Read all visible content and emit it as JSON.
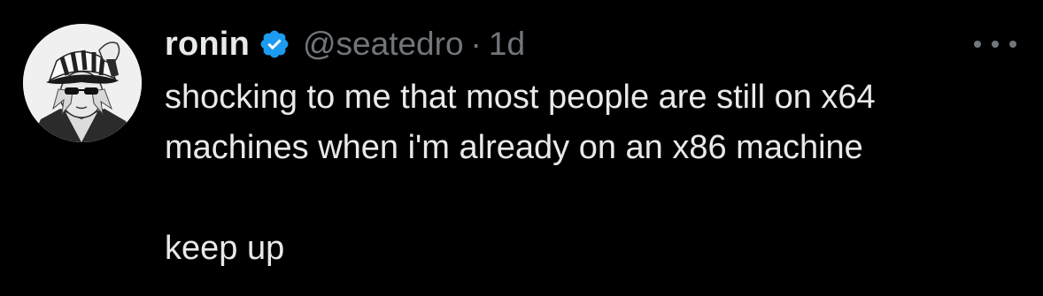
{
  "tweet": {
    "author": {
      "name": "ronin",
      "handle": "@seatedro",
      "verified": true,
      "avatar_icon": "anime-character-avatar"
    },
    "separator": "·",
    "time": "1d",
    "more_icon": "more-horizontal-icon",
    "text_lines": [
      "shocking to me that most people are still on x64",
      "machines when i'm already on an x86 machine",
      "keep up"
    ]
  },
  "colors": {
    "background": "#000000",
    "primary_text": "#e7e9ea",
    "secondary_text": "#71767b",
    "verified_blue": "#1d9bf0"
  }
}
